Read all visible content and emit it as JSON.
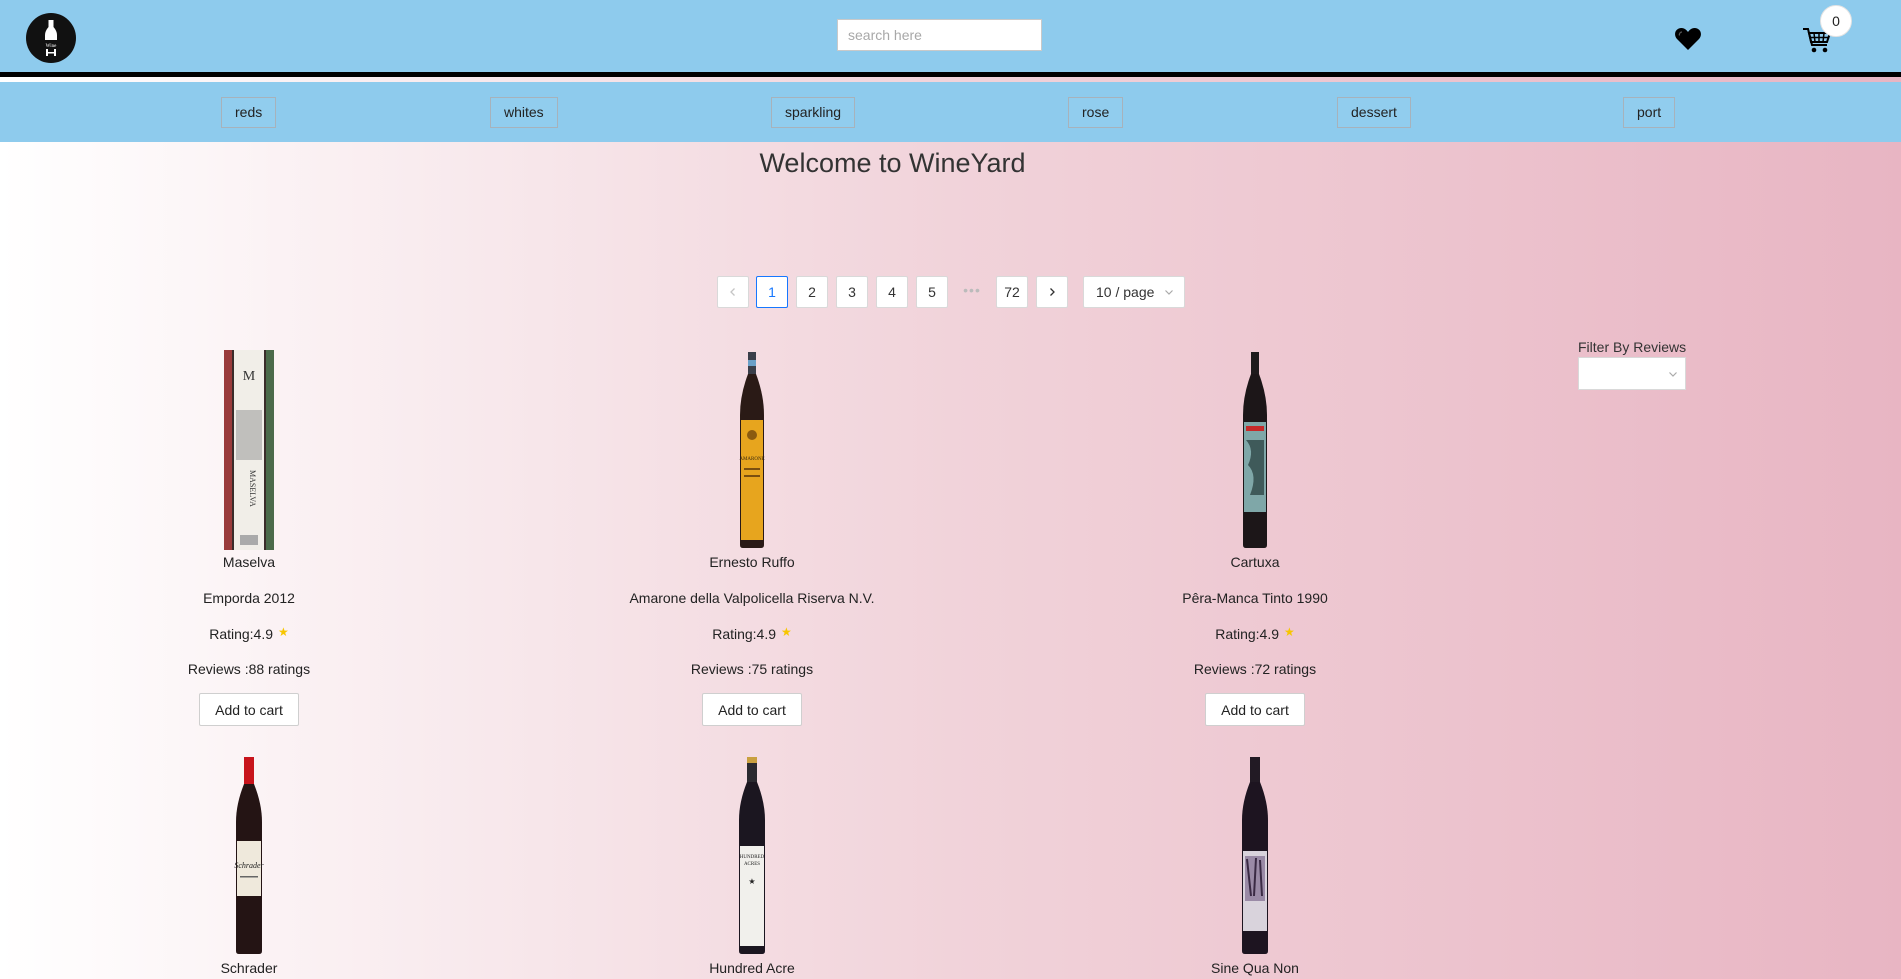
{
  "header": {
    "search_placeholder": "search here",
    "cart_count": "0"
  },
  "nav": {
    "categories": [
      "reds",
      "whites",
      "sparkling",
      "rose",
      "dessert",
      "port"
    ]
  },
  "main": {
    "title": "Welcome to WineYard"
  },
  "pagination": {
    "pages": [
      "1",
      "2",
      "3",
      "4",
      "5"
    ],
    "ellipsis": "•••",
    "last_page": "72",
    "current_page": "1",
    "page_size": "10 / page"
  },
  "filter": {
    "label": "Filter By Reviews",
    "selected": ""
  },
  "products": [
    {
      "winery": "Maselva",
      "wine": "Emporda 2012",
      "rating": "Rating:4.9",
      "reviews": "Reviews :88 ratings",
      "button": "Add to cart"
    },
    {
      "winery": "Ernesto Ruffo",
      "wine": "Amarone della Valpolicella Riserva N.V.",
      "rating": "Rating:4.9",
      "reviews": "Reviews :75 ratings",
      "button": "Add to cart"
    },
    {
      "winery": "Cartuxa",
      "wine": "Pêra-Manca Tinto 1990",
      "rating": "Rating:4.9",
      "reviews": "Reviews :72 ratings",
      "button": "Add to cart"
    },
    {
      "winery": "Schrader"
    },
    {
      "winery": "Hundred Acre"
    },
    {
      "winery": "Sine Qua Non"
    }
  ],
  "colors": {
    "header_bg": "#8ecbed",
    "accent": "#1677ff",
    "star": "#f7c600"
  }
}
